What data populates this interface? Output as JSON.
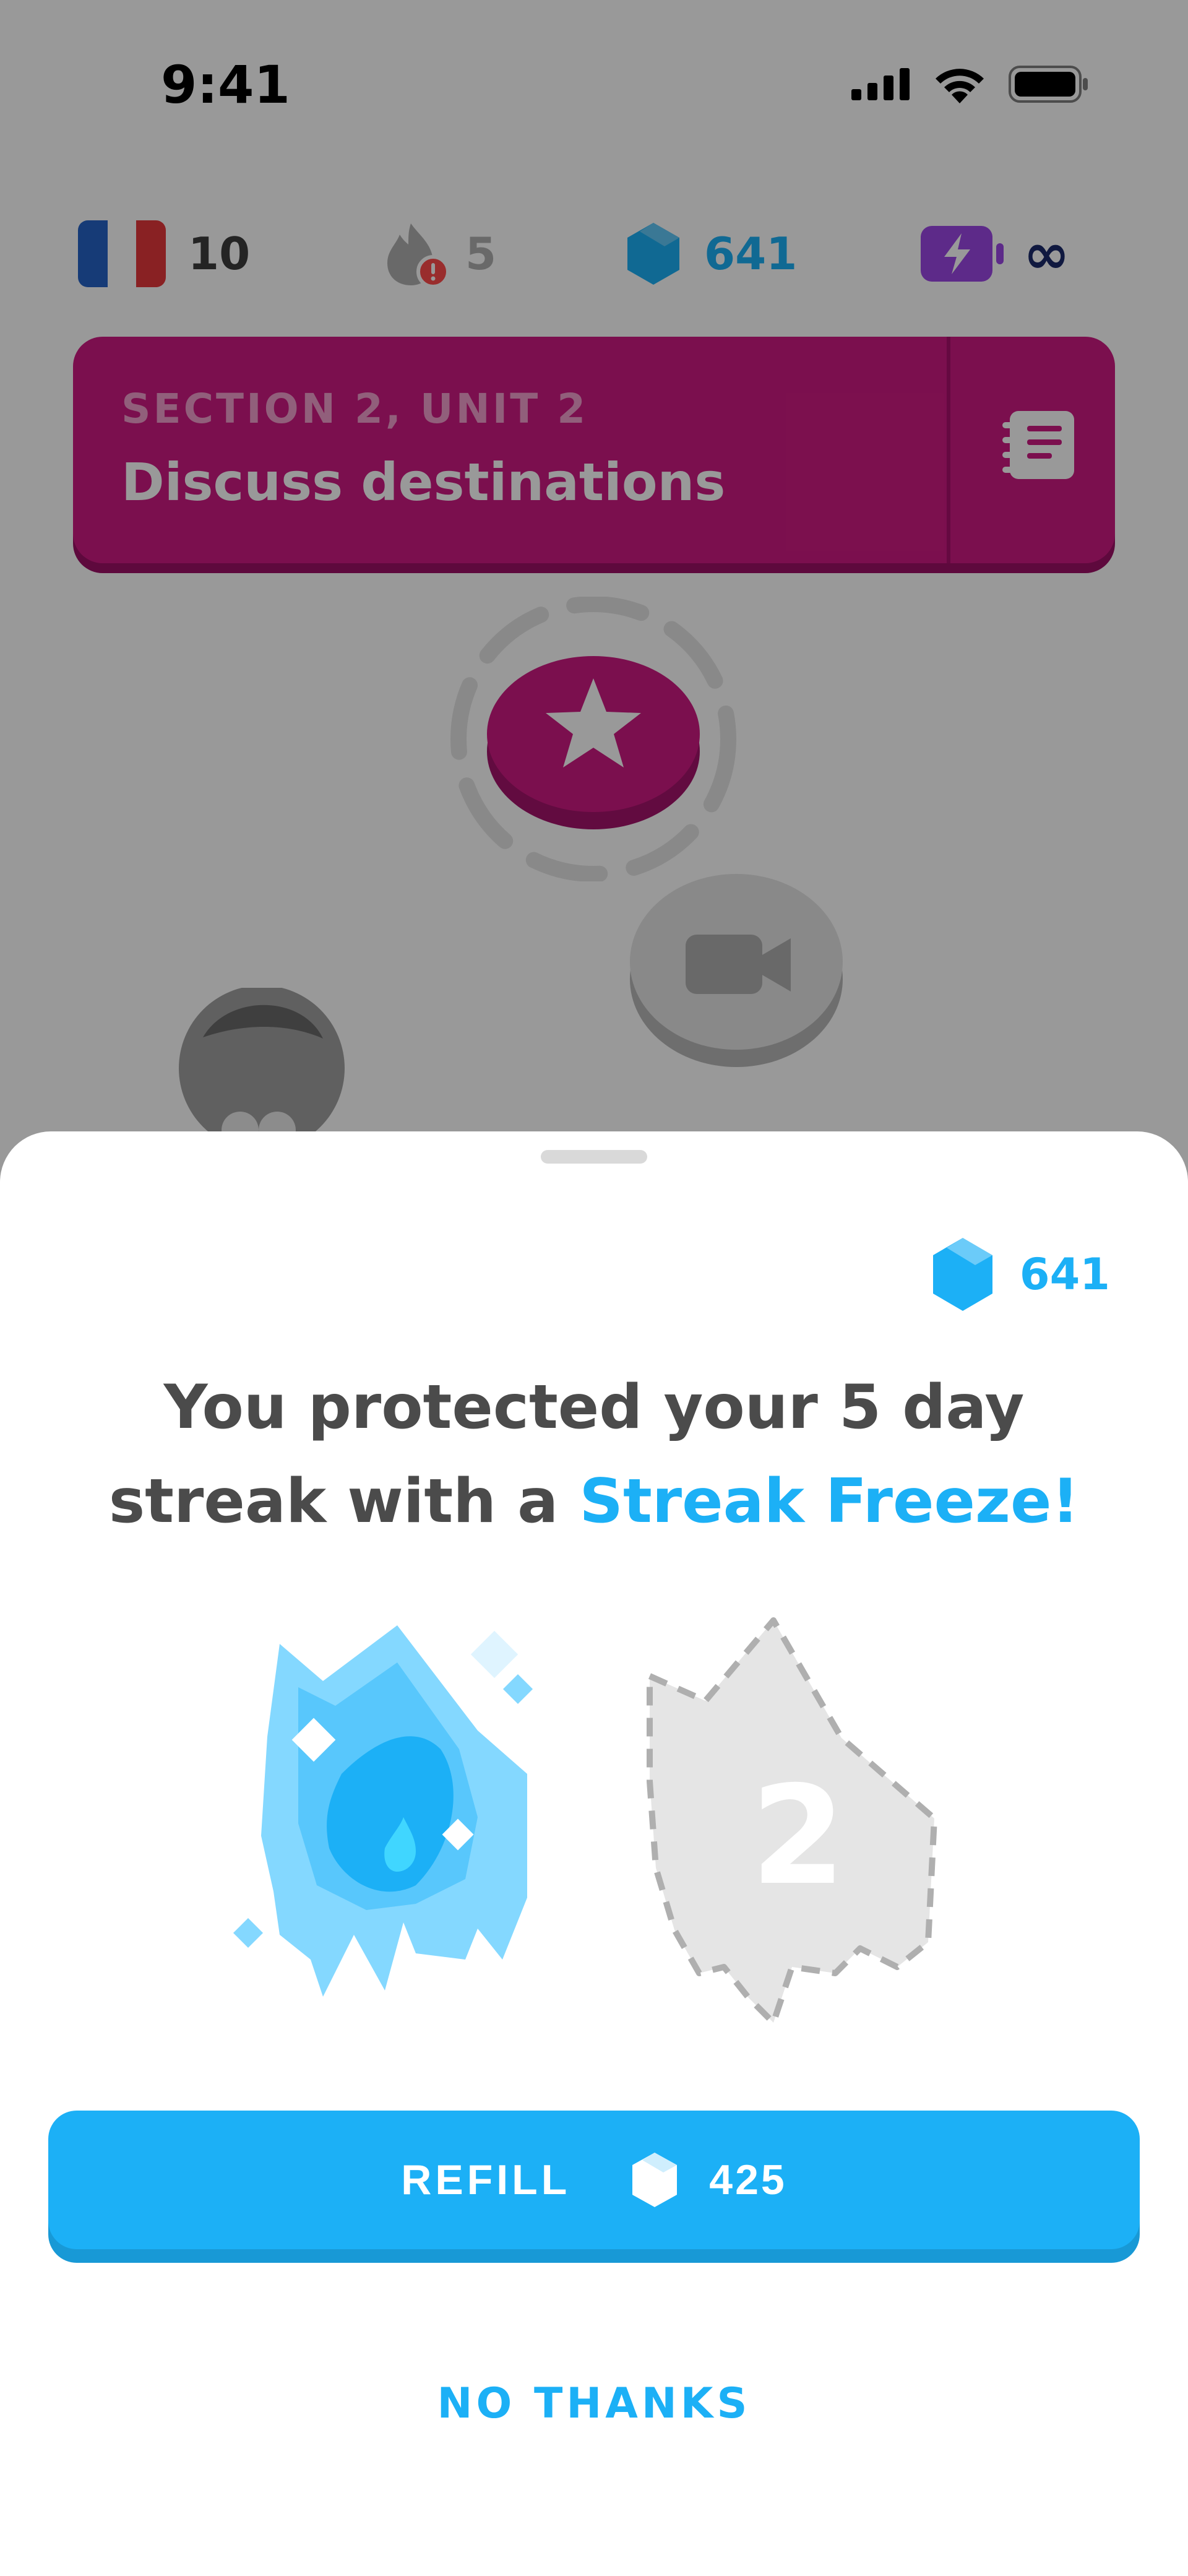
{
  "status_bar": {
    "time": "9:41"
  },
  "header": {
    "course_flag": "french-flag",
    "course_count": "10",
    "streak_count": "5",
    "gems_count": "641",
    "energy": "∞"
  },
  "unit_banner": {
    "overline": "SECTION 2, UNIT 2",
    "title": "Discuss destinations"
  },
  "sheet": {
    "gems": "641",
    "headline_prefix": "You protected your 5 day streak with a ",
    "headline_accent": "Streak Freeze!",
    "empty_slot_number": "2",
    "refill_label": "REFILL",
    "refill_cost": "425",
    "no_thanks_label": "NO THANKS"
  },
  "colors": {
    "accent": "#1cb0f6",
    "unit": "#ce1a82",
    "energy": "#9b46e5"
  }
}
